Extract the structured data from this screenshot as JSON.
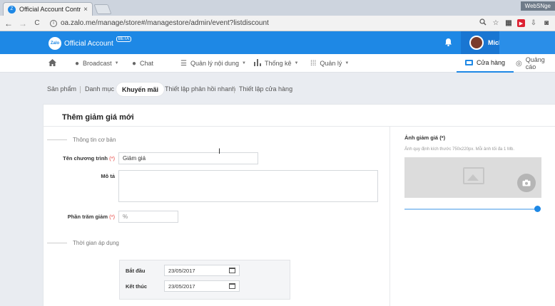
{
  "browser": {
    "tab_title": "Official Account Control",
    "tab_close": "×",
    "window_user": "WebSNge",
    "url": "oa.zalo.me/manage/store#/managestore/admin/event?listdiscount",
    "back": "←",
    "forward": "→",
    "reload": "C",
    "info": "i"
  },
  "header": {
    "logo_mark": "Zalo",
    "logo_text": "Official Account",
    "beta": "BETA",
    "user_name": "MicK"
  },
  "mainnav": {
    "items": [
      {
        "label": "Broadcast",
        "icon": "broadcast-icon"
      },
      {
        "label": "Chat",
        "icon": "chat-icon"
      },
      {
        "label": "Quản lý nội dung",
        "icon": "list-icon"
      },
      {
        "label": "Thống kê",
        "icon": "bar-chart-icon"
      },
      {
        "label": "Quản lý",
        "icon": "grid-icon"
      },
      {
        "label": "Cửa hàng",
        "icon": "store-icon"
      },
      {
        "label": "Quảng cáo",
        "icon": "ads-icon"
      }
    ]
  },
  "subnav": {
    "items": [
      "Sản phẩm",
      "Danh mục",
      "Khuyến mãi",
      "Thiết lập phản hồi nhanh",
      "Thiết lập cửa hàng"
    ],
    "active": "Khuyến mãi"
  },
  "form": {
    "title": "Thêm giảm giá mới",
    "section_basic": "Thông tin cơ bản",
    "name_label": "Tên chương trình",
    "required_mark": "(*)",
    "name_value": "Giảm giá",
    "desc_label": "Mô tả",
    "percent_label": "Phần trăm giảm",
    "percent_placeholder": "%",
    "section_time": "Thời gian áp dụng",
    "start_label": "Bắt đầu",
    "start_value": "23/05/2017",
    "end_label": "Kết thúc",
    "end_value": "23/05/2017"
  },
  "image": {
    "label": "Ảnh giảm giá",
    "required_mark": "(*)",
    "hint": "Ảnh quy định kích thước 750x220px. Mỗi ảnh tối đa 1 Mb.",
    "slider_value": 1.0
  },
  "colors": {
    "brand": "#1e88e5",
    "required": "#e53935"
  }
}
